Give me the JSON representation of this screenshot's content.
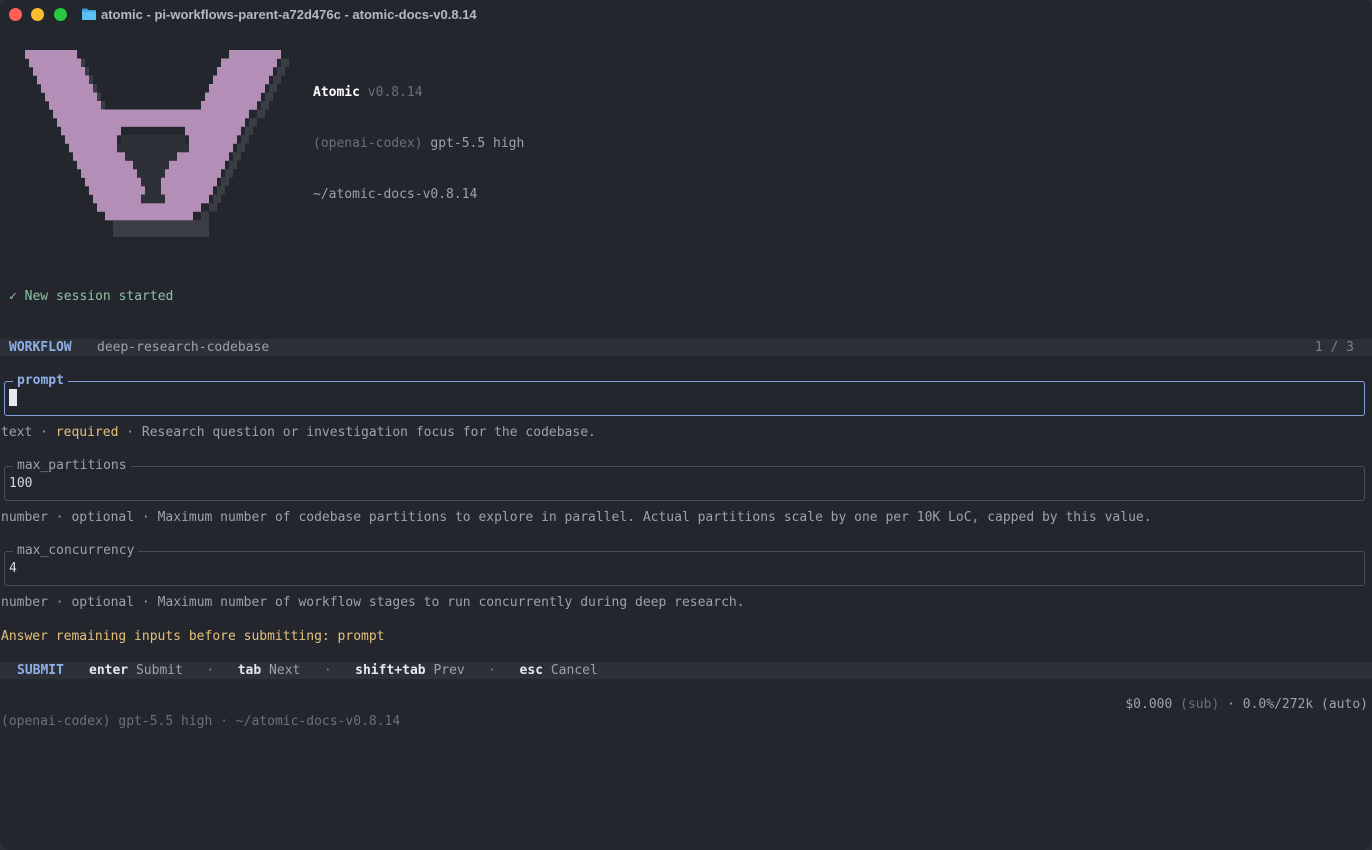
{
  "window": {
    "title": "atomic - pi-workflows-parent-a72d476c - atomic-docs-v0.8.14"
  },
  "header": {
    "app_name": "Atomic",
    "version": "v0.8.14",
    "provider": "(openai-codex)",
    "model": "gpt-5.5 high",
    "cwd": "~/atomic-docs-v0.8.14"
  },
  "session": {
    "status": "✓ New session started"
  },
  "workflow": {
    "label": "WORKFLOW",
    "name": "deep-research-codebase",
    "page": "1 / 3"
  },
  "fields": [
    {
      "label": "prompt",
      "value": "",
      "hint_type": "text",
      "hint_required": "required",
      "hint_desc": "Research question or investigation focus for the codebase."
    },
    {
      "label": "max_partitions",
      "value": "100",
      "hint_type": "number",
      "hint_required": "optional",
      "hint_desc": "Maximum number of codebase partitions to explore in parallel. Actual partitions scale by one per 10K LoC, capped by this value."
    },
    {
      "label": "max_concurrency",
      "value": "4",
      "hint_type": "number",
      "hint_required": "optional",
      "hint_desc": "Maximum number of workflow stages to run concurrently during deep research."
    }
  ],
  "warning": "Answer remaining inputs before submitting: prompt",
  "submit_bar": {
    "label": "SUBMIT",
    "keys": [
      {
        "key": "enter",
        "desc": "Submit"
      },
      {
        "key": "tab",
        "desc": "Next"
      },
      {
        "key": "shift+tab",
        "desc": "Prev"
      },
      {
        "key": "esc",
        "desc": "Cancel"
      }
    ],
    "separator": "·"
  },
  "status": {
    "cost": "$0.000",
    "billing": "(sub)",
    "context": "· 0.0%/272k (auto)",
    "footer_provider": "(openai-codex)",
    "footer_model": "gpt-5.5 high",
    "footer_cwd": "· ~/atomic-docs-v0.8.14"
  },
  "colors": {
    "logo_fill": "#b38fb8",
    "logo_shadow": "#3a3d44",
    "accent": "#8fb0e6",
    "warning": "#e5c07b",
    "success": "#8ec1a6"
  }
}
